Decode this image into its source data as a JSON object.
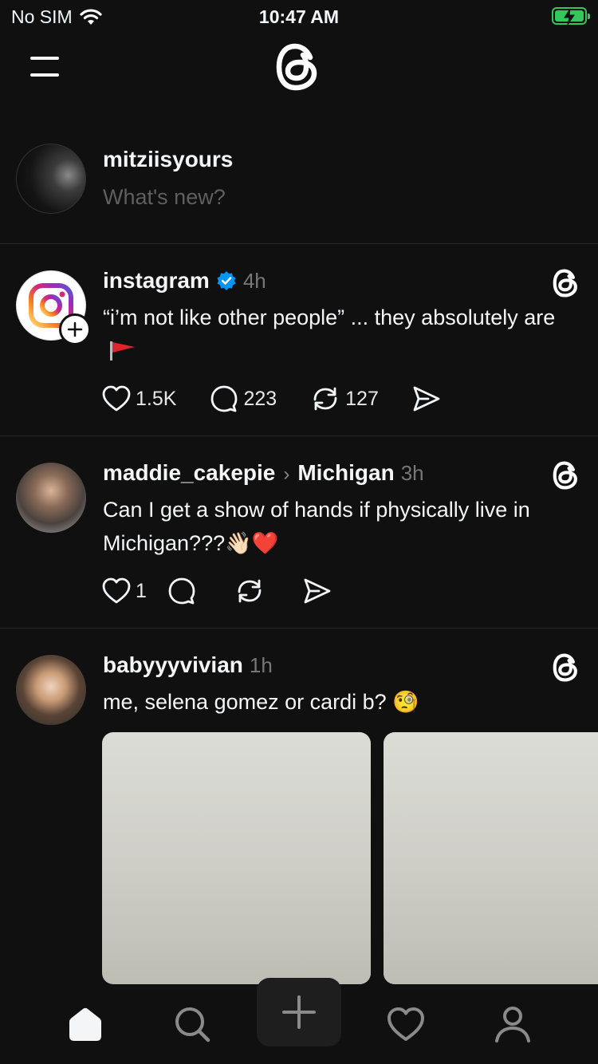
{
  "status_bar": {
    "carrier": "No SIM",
    "time": "10:47 AM"
  },
  "composer": {
    "username": "mitziisyours",
    "placeholder": "What's new?"
  },
  "posts": [
    {
      "user": "instagram",
      "verified": true,
      "time": "4h",
      "text": "“i’m not like other people” ... they absolutely are",
      "likes": "1.5K",
      "replies": "223",
      "reposts": "127"
    },
    {
      "user": "maddie_cakepie",
      "community": "Michigan",
      "time": "3h",
      "text": "Can I get a show of hands if physically live in Michigan???👋🏻❤️",
      "likes": "1"
    },
    {
      "user": "babyyyvivian",
      "time": "1h",
      "text": "me, selena gomez or cardi b? 🧐"
    }
  ],
  "tab_bar": [
    "home-icon",
    "search-icon",
    "compose-icon",
    "activity-heart-icon",
    "profile-icon"
  ],
  "colors": {
    "background": "#101010",
    "text": "#f3f5f7",
    "muted": "#777777",
    "verified": "#0095f6"
  }
}
